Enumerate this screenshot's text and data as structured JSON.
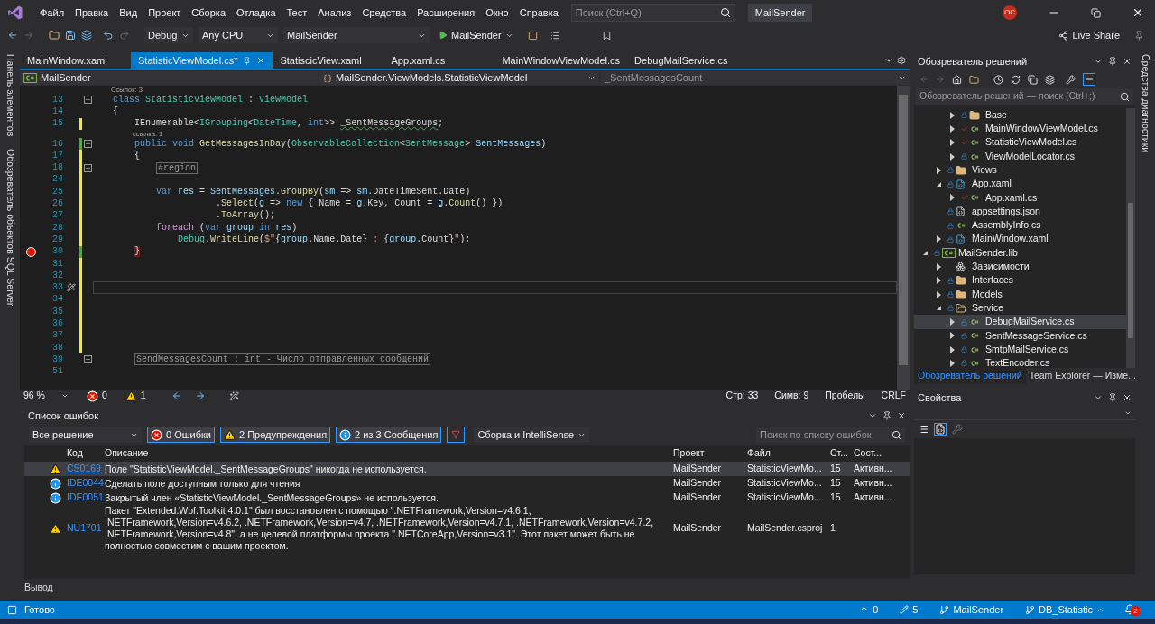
{
  "title_bar": {
    "menu": [
      "Файл",
      "Правка",
      "Вид",
      "Проект",
      "Сборка",
      "Отладка",
      "Тест",
      "Анализ",
      "Средства",
      "Расширения",
      "Окно",
      "Справка"
    ],
    "search": {
      "placeholder": "Поиск (Ctrl+Q)"
    },
    "solution_name": "MailSender",
    "avatar": "ОС"
  },
  "toolbar": {
    "configuration": "Debug",
    "platform": "Any CPU",
    "startup_project": "MailSender",
    "run_target": "MailSender",
    "live_share": "Live Share"
  },
  "left_strip": [
    "Панель элементов",
    "Обозреватель объектов SQL Server"
  ],
  "right_strip": [
    "Средства диагностики"
  ],
  "editor_tabs": [
    {
      "label": "MainWindow.xaml",
      "selected": false
    },
    {
      "label": "StatisticViewModel.cs*",
      "selected": true
    },
    {
      "label": "StatiscicView.xaml",
      "selected": false
    },
    {
      "label": "App.xaml.cs",
      "selected": false
    },
    {
      "label": "MainWindowViewModel.cs",
      "selected": false
    },
    {
      "label": "DebugMailService.cs",
      "selected": false
    }
  ],
  "nav_bar": {
    "project": "MailSender",
    "type": "MailSender.ViewModels.StatisticViewModel",
    "member": "_SentMessagesCount"
  },
  "code_lines": [
    {
      "kind": "lens",
      "text": "Ссылок: 3"
    },
    {
      "kind": "code",
      "number": "13",
      "expanded": true,
      "breakpoint": false,
      "current": false,
      "tokens": [
        {
          "text": "class ",
          "kind": "kw"
        },
        {
          "text": "StatisticViewModel",
          "kind": "type"
        },
        {
          "text": " : ",
          "kind": "plain"
        },
        {
          "text": "ViewModel",
          "kind": "type"
        }
      ]
    },
    {
      "kind": "code",
      "number": "14",
      "breakpoint": false,
      "current": false,
      "tokens": [
        {
          "text": "{",
          "kind": "plain"
        }
      ]
    },
    {
      "kind": "code",
      "number": "15",
      "saved": false,
      "breakpoint": false,
      "current": false,
      "tokens": [
        {
          "text": "    IEnumerable<",
          "kind": "plain"
        },
        {
          "text": "IGrouping",
          "kind": "type"
        },
        {
          "text": "<",
          "kind": "plain"
        },
        {
          "text": "DateTime",
          "kind": "type"
        },
        {
          "text": ", ",
          "kind": "plain"
        },
        {
          "text": "int",
          "kind": "kw"
        },
        {
          "text": ">> ",
          "kind": "plain"
        },
        {
          "text": "_SentMessageGroups",
          "kind": "warn"
        },
        {
          "text": ";",
          "kind": "plain"
        }
      ]
    },
    {
      "kind": "lens",
      "text": "ссылка: 1"
    },
    {
      "kind": "code",
      "number": "16",
      "expanded": true,
      "saved": true,
      "breakpoint": false,
      "current": false,
      "tokens": [
        {
          "text": "    public void ",
          "kind": "kw"
        },
        {
          "text": "GetMessagesInDay",
          "kind": "method"
        },
        {
          "text": "(",
          "kind": "plain"
        },
        {
          "text": "ObservableCollection",
          "kind": "type"
        },
        {
          "text": "<",
          "kind": "plain"
        },
        {
          "text": "SentMessage",
          "kind": "type"
        },
        {
          "text": "> ",
          "kind": "plain"
        },
        {
          "text": "SentMessages",
          "kind": "param"
        },
        {
          "text": ")",
          "kind": "plain"
        }
      ]
    },
    {
      "kind": "code",
      "number": "17",
      "saved": false,
      "breakpoint": false,
      "current": false,
      "tokens": [
        {
          "text": "    {",
          "kind": "plain"
        }
      ]
    },
    {
      "kind": "code",
      "number": "18",
      "expanded": false,
      "saved": false,
      "breakpoint": false,
      "current": false,
      "tokens": [
        {
          "text": "        #region",
          "kind": "collapsed"
        }
      ]
    },
    {
      "kind": "code",
      "number": "24",
      "saved": false,
      "breakpoint": false,
      "current": false
    },
    {
      "kind": "code",
      "number": "25",
      "saved": false,
      "breakpoint": false,
      "current": false,
      "tokens": [
        {
          "text": "        var ",
          "kind": "kw"
        },
        {
          "text": "res",
          "kind": "param"
        },
        {
          "text": " = ",
          "kind": "plain"
        },
        {
          "text": "SentMessages",
          "kind": "param"
        },
        {
          "text": ".",
          "kind": "plain"
        },
        {
          "text": "GroupBy",
          "kind": "method"
        },
        {
          "text": "(",
          "kind": "plain"
        },
        {
          "text": "sm",
          "kind": "param"
        },
        {
          "text": " => ",
          "kind": "plain"
        },
        {
          "text": "sm",
          "kind": "param"
        },
        {
          "text": ".DateTimeSent.Date)",
          "kind": "plain"
        }
      ]
    },
    {
      "kind": "code",
      "number": "26",
      "saved": false,
      "breakpoint": false,
      "current": false,
      "tokens": [
        {
          "text": "                   .",
          "kind": "plain"
        },
        {
          "text": "Select",
          "kind": "method"
        },
        {
          "text": "(",
          "kind": "plain"
        },
        {
          "text": "g",
          "kind": "param"
        },
        {
          "text": " => ",
          "kind": "plain"
        },
        {
          "text": "new",
          "kind": "kw"
        },
        {
          "text": " { Name = ",
          "kind": "plain"
        },
        {
          "text": "g",
          "kind": "param"
        },
        {
          "text": ".Key, Count = ",
          "kind": "plain"
        },
        {
          "text": "g",
          "kind": "param"
        },
        {
          "text": ".",
          "kind": "plain"
        },
        {
          "text": "Count",
          "kind": "method"
        },
        {
          "text": "() })",
          "kind": "plain"
        }
      ]
    },
    {
      "kind": "code",
      "number": "27",
      "saved": false,
      "breakpoint": false,
      "current": false,
      "tokens": [
        {
          "text": "                   .",
          "kind": "plain"
        },
        {
          "text": "ToArray",
          "kind": "method"
        },
        {
          "text": "();",
          "kind": "plain"
        }
      ]
    },
    {
      "kind": "code",
      "number": "28",
      "saved": false,
      "breakpoint": false,
      "current": false,
      "tokens": [
        {
          "text": "        foreach",
          "kind": "ctrl"
        },
        {
          "text": " (",
          "kind": "plain"
        },
        {
          "text": "var ",
          "kind": "kw"
        },
        {
          "text": "group",
          "kind": "param"
        },
        {
          "text": " in ",
          "kind": "kw"
        },
        {
          "text": "res",
          "kind": "param"
        },
        {
          "text": ")",
          "kind": "plain"
        }
      ]
    },
    {
      "kind": "code",
      "number": "29",
      "saved": false,
      "breakpoint": false,
      "current": false,
      "tokens": [
        {
          "text": "            Debug",
          "kind": "type"
        },
        {
          "text": ".",
          "kind": "plain"
        },
        {
          "text": "WriteLine",
          "kind": "method"
        },
        {
          "text": "(",
          "kind": "plain"
        },
        {
          "text": "$\"",
          "kind": "str"
        },
        {
          "text": "{",
          "kind": "plain"
        },
        {
          "text": "group",
          "kind": "param"
        },
        {
          "text": ".Name.Date}",
          "kind": "plain"
        },
        {
          "text": " : ",
          "kind": "str"
        },
        {
          "text": "{",
          "kind": "plain"
        },
        {
          "text": "group",
          "kind": "param"
        },
        {
          "text": ".Count}",
          "kind": "plain"
        },
        {
          "text": "\"",
          "kind": "str"
        },
        {
          "text": ");",
          "kind": "plain"
        }
      ]
    },
    {
      "kind": "code",
      "number": "30",
      "saved": true,
      "breakpoint": true,
      "current": false,
      "tokens": [
        {
          "text": "    }",
          "kind": "bp"
        }
      ]
    },
    {
      "kind": "code",
      "number": "31",
      "saved": false,
      "breakpoint": false,
      "current": false
    },
    {
      "kind": "code",
      "number": "32",
      "saved": false,
      "breakpoint": false,
      "current": false
    },
    {
      "kind": "code",
      "number": "33",
      "saved": false,
      "breakpoint": false,
      "current": true
    },
    {
      "kind": "code",
      "number": "34",
      "saved": false,
      "breakpoint": false,
      "current": false
    },
    {
      "kind": "code",
      "number": "35",
      "saved": false,
      "breakpoint": false,
      "current": false
    },
    {
      "kind": "code",
      "number": "36",
      "saved": false,
      "breakpoint": false,
      "current": false
    },
    {
      "kind": "code",
      "number": "37",
      "saved": false,
      "breakpoint": false,
      "current": false
    },
    {
      "kind": "code",
      "number": "38",
      "saved": false,
      "breakpoint": false,
      "current": false
    },
    {
      "kind": "code",
      "number": "39",
      "expanded": false,
      "breakpoint": false,
      "current": false,
      "tokens": [
        {
          "text": "    SendMessagesCount : int - Число отправленных сообщений",
          "kind": "collapsed"
        }
      ]
    },
    {
      "kind": "code",
      "number": "51",
      "breakpoint": false,
      "current": false
    }
  ],
  "editor_status": {
    "zoom": "96 %",
    "errors": "0",
    "warnings": "1",
    "line": "Стр: 33",
    "column": "Симв: 9",
    "whitespace": "Пробелы",
    "line_endings": "CRLF"
  },
  "error_list": {
    "title": "Список ошибок",
    "scope": "Все решение",
    "filters": [
      {
        "kind": "error",
        "label": "0 Ошибки",
        "selected": true
      },
      {
        "kind": "warning",
        "label": "2 Предупреждения",
        "selected": true
      },
      {
        "kind": "info",
        "label": "2 из 3 Сообщения",
        "selected": true
      }
    ],
    "source": "Сборка и IntelliSense",
    "search": {
      "placeholder": "Поиск по списку ошибок"
    },
    "columns": [
      "Код",
      "Описание",
      "Проект",
      "Файл",
      "Ст...",
      "Сост..."
    ],
    "rows": [
      {
        "kind": "warning",
        "code": "CS0169",
        "description": "Поле \"StatisticViewModel._SentMessageGroups\" никогда не используется.",
        "project": "MailSender",
        "file": "StatisticViewMo...",
        "line": "15",
        "state": "Активн...",
        "selected": true
      },
      {
        "kind": "info",
        "code": "IDE0044",
        "description": "Сделать поле доступным только для чтения",
        "project": "MailSender",
        "file": "StatisticViewMo...",
        "line": "15",
        "state": "Активн...",
        "selected": false
      },
      {
        "kind": "info",
        "code": "IDE0051",
        "description": "Закрытый член «StatisticViewModel._SentMessageGroups» не используется.",
        "project": "MailSender",
        "file": "StatisticViewMo...",
        "line": "15",
        "state": "Активн...",
        "selected": false
      },
      {
        "kind": "warning",
        "code": "NU1701",
        "description": "Пакет \"Extended.Wpf.Toolkit 4.0.1\" был восстановлен с помощью \".NETFramework,Version=v4.6.1, .NETFramework,Version=v4.6.2, .NETFramework,Version=v4.7, .NETFramework,Version=v4.7.1, .NETFramework,Version=v4.7.2, .NETFramework,Version=v4.8\", а не целевой платформы проекта \".NETCoreApp,Version=v3.1\". Этот пакет может быть не полностью совместим с вашим проектом.",
        "project": "MailSender",
        "file": "MailSender.csproj",
        "line": "1",
        "selected": false
      }
    ]
  },
  "output_tab": "Вывод",
  "solution_explorer": {
    "title": "Обозреватель решений",
    "search": {
      "placeholder": "Обозреватель решений — поиск (Ctrl+;)"
    },
    "tree": [
      {
        "children": [
          {
            "children": [
              {
                "label": "Base",
                "kind": "folder",
                "edited": false,
                "expanded": false,
                "selected": false
              },
              {
                "label": "MainWindowViewModel.cs",
                "kind": "cs",
                "edited": true,
                "expanded": false,
                "selected": false
              },
              {
                "label": "StatisticViewModel.cs",
                "kind": "cs",
                "edited": true,
                "expanded": false,
                "selected": false
              },
              {
                "label": "ViewModelLocator.cs",
                "kind": "cs",
                "edited": false,
                "expanded": false,
                "selected": false
              }
            ]
          },
          {
            "label": "Views",
            "kind": "folder",
            "edited": false,
            "expanded": false,
            "selected": false
          },
          {
            "label": "App.xaml",
            "kind": "xaml",
            "edited": false,
            "expanded": true,
            "selected": false,
            "children": [
              {
                "label": "App.xaml.cs",
                "kind": "cs",
                "edited": true,
                "expanded": false,
                "selected": false
              }
            ]
          },
          {
            "label": "appsettings.json",
            "kind": "json",
            "edited": false,
            "selected": false
          },
          {
            "label": "AssemblyInfo.cs",
            "kind": "cs",
            "edited": false,
            "selected": false
          },
          {
            "label": "MainWindow.xaml",
            "kind": "xaml",
            "edited": false,
            "expanded": false,
            "selected": false
          }
        ]
      },
      {
        "label": "MailSender.lib",
        "kind": "project",
        "edited": false,
        "expanded": true,
        "selected": false,
        "children": [
          {
            "label": "Зависимости",
            "kind": "deps",
            "expanded": false,
            "selected": false
          },
          {
            "label": "Interfaces",
            "kind": "folder",
            "edited": false,
            "expanded": false,
            "selected": false
          },
          {
            "label": "Models",
            "kind": "folder",
            "edited": false,
            "expanded": false,
            "selected": false
          },
          {
            "label": "Service",
            "kind": "folder",
            "edited": false,
            "expanded": true,
            "selected": false,
            "children": [
              {
                "label": "DebugMailService.cs",
                "kind": "cs",
                "edited": false,
                "expanded": false,
                "selected": true
              },
              {
                "label": "SentMessageService.cs",
                "kind": "cs",
                "edited": false,
                "expanded": false,
                "selected": false
              },
              {
                "label": "SmtpMailService.cs",
                "kind": "cs",
                "edited": false,
                "expanded": false,
                "selected": false
              },
              {
                "label": "TextEncoder.cs",
                "kind": "cs",
                "edited": false,
                "expanded": false,
                "selected": false
              }
            ]
          }
        ]
      }
    ],
    "bottom_tabs": [
      {
        "label": "Обозреватель решений",
        "selected": true
      },
      {
        "label": "Team Explorer — Изме...",
        "selected": false
      }
    ]
  },
  "properties": {
    "title": "Свойства"
  },
  "status_bar": {
    "message": "Готово",
    "pushes": "0",
    "changes": "5",
    "repository": "MailSender",
    "branch": "DB_Statistic",
    "notifications": "2"
  }
}
